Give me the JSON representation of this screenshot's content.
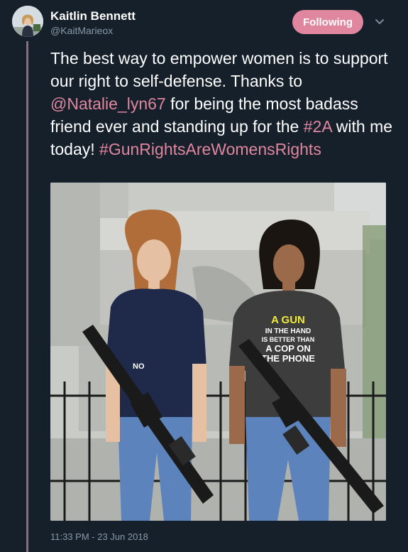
{
  "user": {
    "name": "Kaitlin Bennett",
    "handle": "@KaitMarieox",
    "follow_label": "Following"
  },
  "tweet": {
    "segments": [
      {
        "text": "The best way to empower women is to support our right to self-defense. Thanks to ",
        "type": "text"
      },
      {
        "text": "@Natalie_lyn67",
        "type": "mention"
      },
      {
        "text": " for being the most badass friend ever and standing up for the ",
        "type": "text"
      },
      {
        "text": "#2A",
        "type": "hashtag"
      },
      {
        "text": " with me today! ",
        "type": "text"
      },
      {
        "text": "#GunRightsAreWomensRights",
        "type": "hashtag"
      }
    ],
    "timestamp": "11:33 PM - 23 Jun 2018"
  },
  "photo": {
    "shirt_text_lines": [
      "A GUN",
      "IN THE HAND",
      "IS BETTER THAN",
      "A COP ON",
      "THE PHONE"
    ],
    "left_shirt_text": "NO"
  },
  "colors": {
    "background": "#15202b",
    "accent": "#e0869f",
    "muted": "#8899a6",
    "thread": "#8a6a86"
  },
  "icons": {
    "caret": "chevron-down-icon"
  }
}
